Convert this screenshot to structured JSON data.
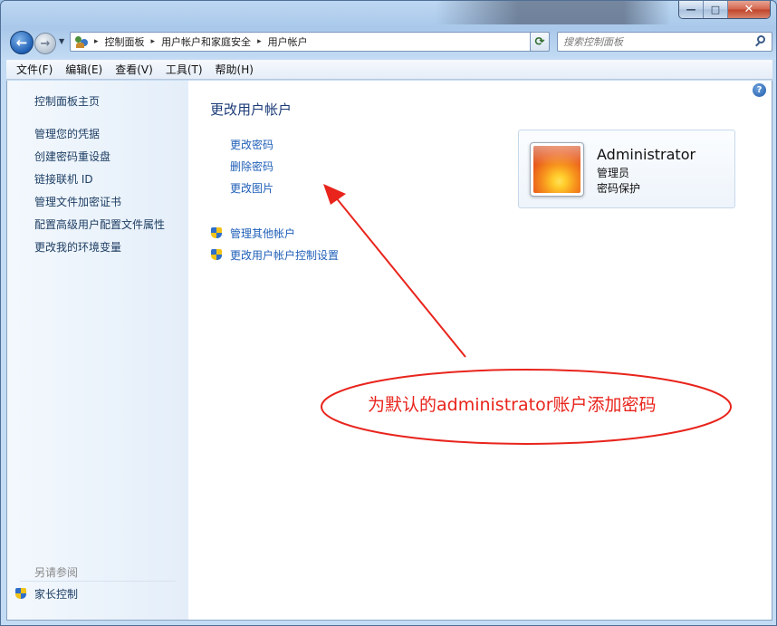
{
  "window": {
    "minimize_glyph": "—",
    "maximize_glyph": "□",
    "close_glyph": "✕"
  },
  "nav": {
    "back_glyph": "←",
    "forward_glyph": "→",
    "history_glyph": "▼",
    "breadcrumbs": [
      "控制面板",
      "用户帐户和家庭安全",
      "用户帐户"
    ],
    "breadcrumb_sep": "▸",
    "dropdown_glyph": "▼",
    "refresh_glyph": "⟳",
    "search_placeholder": "搜索控制面板"
  },
  "menu": [
    "文件(F)",
    "编辑(E)",
    "查看(V)",
    "工具(T)",
    "帮助(H)"
  ],
  "sidebar": {
    "home": "控制面板主页",
    "links": [
      "管理您的凭据",
      "创建密码重设盘",
      "链接联机 ID",
      "管理文件加密证书",
      "配置高级用户配置文件属性",
      "更改我的环境变量"
    ],
    "see_also": "另请参阅",
    "parental": "家长控制"
  },
  "main": {
    "help_glyph": "?",
    "title": "更改用户帐户",
    "tasks": [
      "更改密码",
      "删除密码",
      "更改图片"
    ],
    "shield_tasks": [
      "管理其他帐户",
      "更改用户帐户控制设置"
    ]
  },
  "user": {
    "name": "Administrator",
    "role": "管理员",
    "password_status": "密码保护"
  },
  "annotation": {
    "text": "为默认的administrator账户添加密码",
    "color": "#e8241c"
  },
  "colors": {
    "link": "#1f5fb8",
    "title": "#1b3b78"
  }
}
